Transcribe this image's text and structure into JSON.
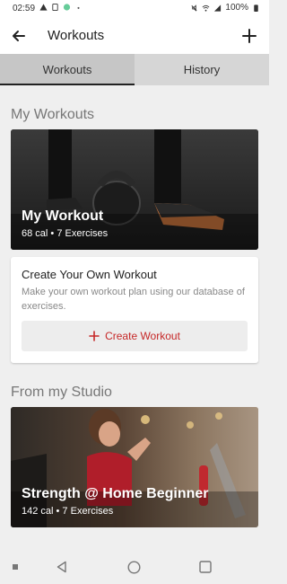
{
  "status_bar": {
    "time": "02:59",
    "left_icons": [
      "warning-icon",
      "sim-icon",
      "android-icon",
      "dot-icon"
    ],
    "right_icons": [
      "mute-icon",
      "wifi-icon",
      "signal-icon"
    ],
    "battery": "100%"
  },
  "app_bar": {
    "title": "Workouts",
    "back_icon": "arrow-left-icon",
    "add_icon": "plus-icon"
  },
  "tabs": [
    {
      "label": "Workouts",
      "active": true
    },
    {
      "label": "History",
      "active": false
    }
  ],
  "my_workouts": {
    "section_title": "My Workouts",
    "card": {
      "name": "My Workout",
      "meta": "68 cal • 7 Exercises"
    }
  },
  "create": {
    "heading": "Create Your Own Workout",
    "description": "Make your own workout plan using our database of exercises.",
    "button_label": "Create Workout",
    "accent": "#c62828"
  },
  "studio": {
    "section_title": "From my Studio",
    "card": {
      "name": "Strength @ Home Beginner",
      "meta": "142 cal • 7 Exercises"
    }
  },
  "nav": [
    "recents-square-icon",
    "back-triangle-icon",
    "home-circle-icon",
    "overview-square-icon"
  ]
}
